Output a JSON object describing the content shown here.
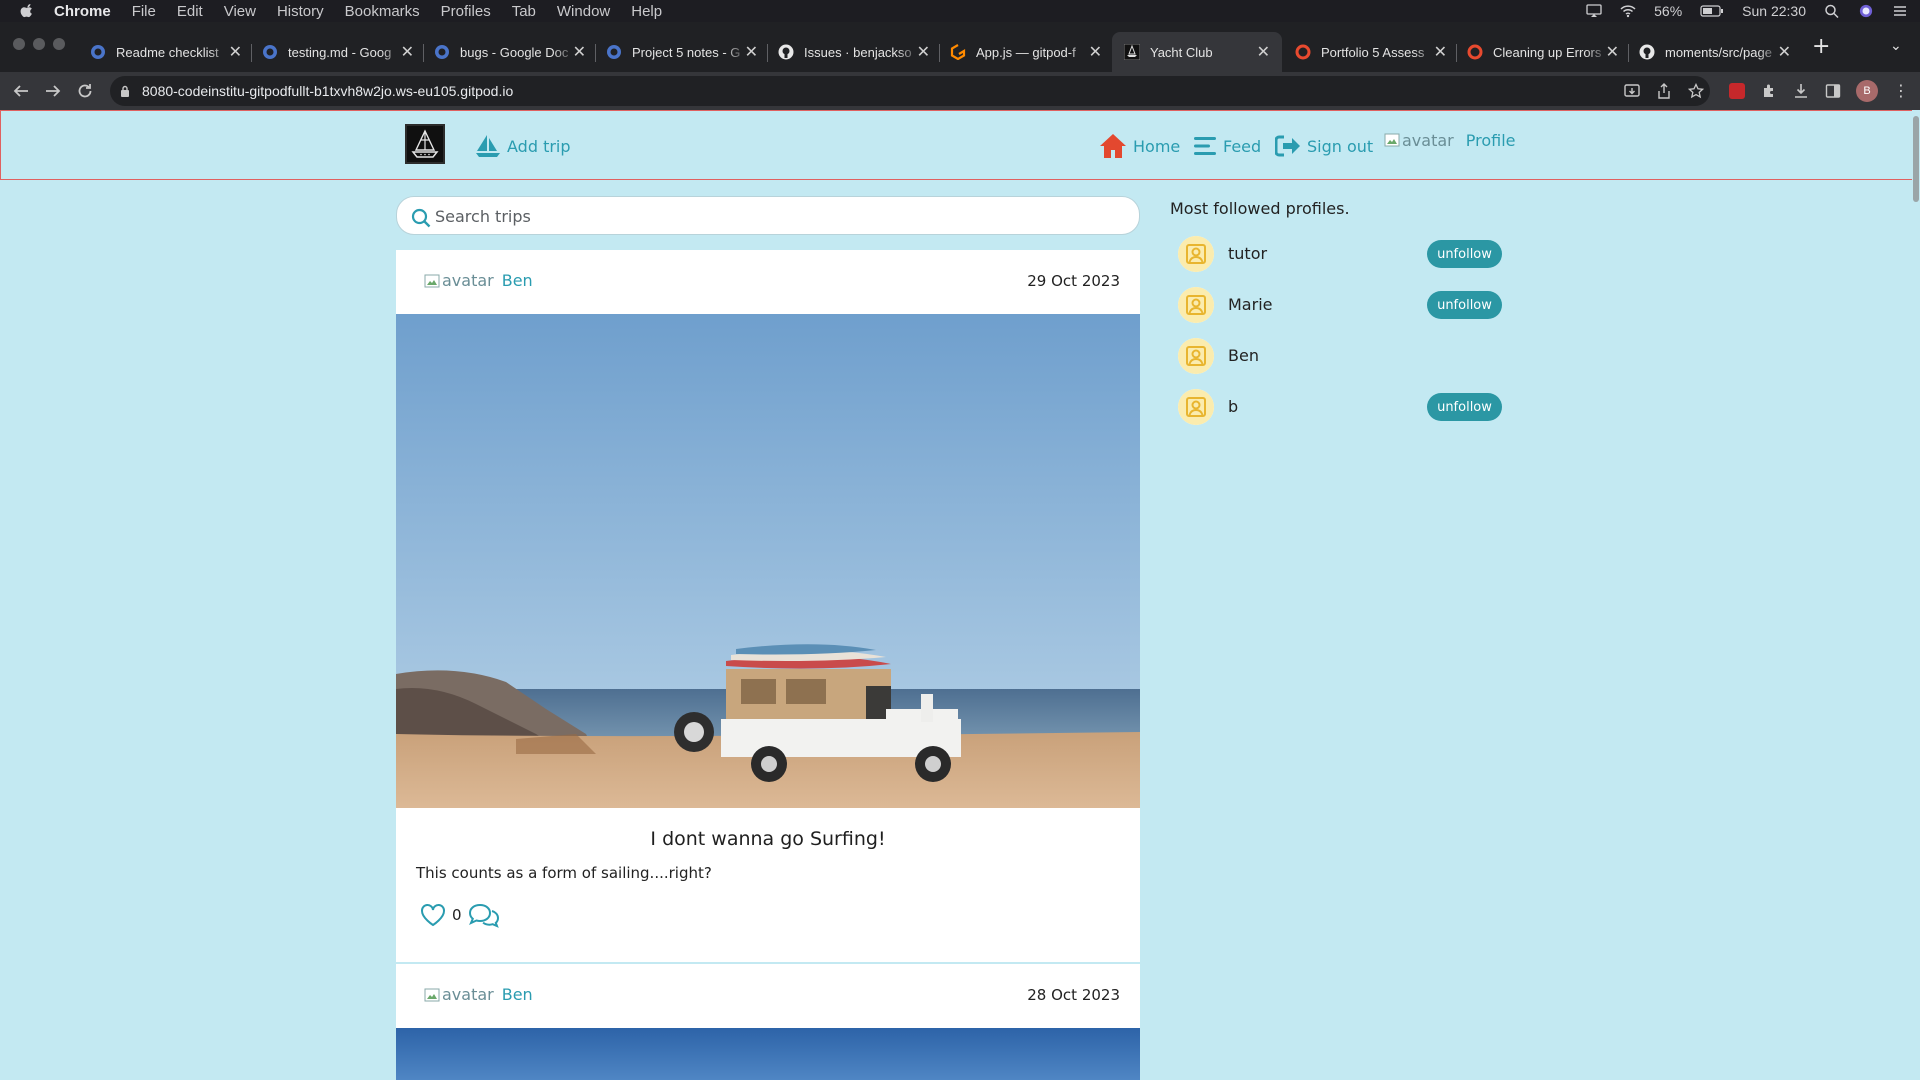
{
  "mac_menu": {
    "items": [
      "Chrome",
      "File",
      "Edit",
      "View",
      "History",
      "Bookmarks",
      "Profiles",
      "Tab",
      "Window",
      "Help"
    ],
    "battery": "56%",
    "clock": "Sun 22:30"
  },
  "browser": {
    "tabs": [
      {
        "title": "Readme checklist",
        "icon": "google-docs-icon"
      },
      {
        "title": "testing.md - Goog",
        "icon": "google-docs-icon"
      },
      {
        "title": "bugs - Google Doc",
        "icon": "google-docs-icon"
      },
      {
        "title": "Project 5 notes - G",
        "icon": "google-docs-icon"
      },
      {
        "title": "Issues · benjackso",
        "icon": "github-icon"
      },
      {
        "title": "App.js — gitpod-f",
        "icon": "gitpod-icon"
      },
      {
        "title": "Yacht Club",
        "icon": "yacht-logo-icon",
        "active": true
      },
      {
        "title": "Portfolio 5 Assess",
        "icon": "lms-icon"
      },
      {
        "title": "Cleaning up Errors",
        "icon": "lms-icon"
      },
      {
        "title": "moments/src/page",
        "icon": "github-icon"
      }
    ],
    "url": "8080-codeinstitu-gitpodfullt-b1txvh8w2jo.ws-eu105.gitpod.io",
    "profile_initial": "B"
  },
  "site_nav": {
    "add_trip": "Add trip",
    "home": "Home",
    "feed": "Feed",
    "sign_out": "Sign out",
    "avatar_alt": "avatar",
    "profile": "Profile"
  },
  "search": {
    "placeholder": "Search trips"
  },
  "posts": [
    {
      "owner": "Ben",
      "avatar_alt": "avatar",
      "date": "29 Oct 2023",
      "title": "I dont wanna go Surfing!",
      "body": "This counts as a form of sailing....right?",
      "likes": "0"
    },
    {
      "owner": "Ben",
      "avatar_alt": "avatar",
      "date": "28 Oct 2023"
    }
  ],
  "sidebar": {
    "title": "Most followed profiles.",
    "profiles": [
      {
        "name": "tutor",
        "button": "unfollow"
      },
      {
        "name": "Marie",
        "button": "unfollow"
      },
      {
        "name": "Ben",
        "button": ""
      },
      {
        "name": "b",
        "button": "unfollow"
      }
    ]
  },
  "colors": {
    "page_background": "#c3e9f2",
    "accent": "#2a9cb0",
    "button": "#2b97a4",
    "home_icon": "#e3482f"
  }
}
